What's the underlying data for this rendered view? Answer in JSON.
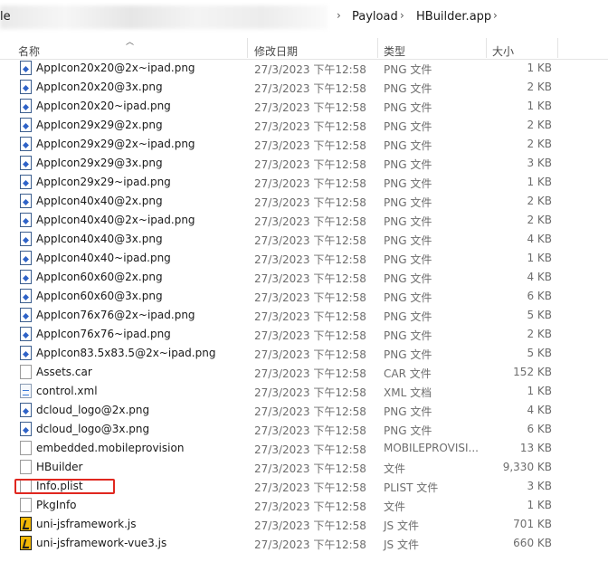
{
  "address_bar": {
    "prefix": "le",
    "breadcrumbs": [
      "Payload",
      "HBuilder.app"
    ],
    "separator": "›"
  },
  "columns": {
    "name": "名称",
    "date": "修改日期",
    "type": "类型",
    "size": "大小"
  },
  "files": [
    {
      "name": "AppIcon20x20@2x~ipad.png",
      "date": "27/3/2023 下午12:58",
      "type": "PNG 文件",
      "size": "1 KB",
      "icon": "png-file-icon"
    },
    {
      "name": "AppIcon20x20@3x.png",
      "date": "27/3/2023 下午12:58",
      "type": "PNG 文件",
      "size": "2 KB",
      "icon": "png-file-icon"
    },
    {
      "name": "AppIcon20x20~ipad.png",
      "date": "27/3/2023 下午12:58",
      "type": "PNG 文件",
      "size": "1 KB",
      "icon": "png-file-icon"
    },
    {
      "name": "AppIcon29x29@2x.png",
      "date": "27/3/2023 下午12:58",
      "type": "PNG 文件",
      "size": "2 KB",
      "icon": "png-file-icon"
    },
    {
      "name": "AppIcon29x29@2x~ipad.png",
      "date": "27/3/2023 下午12:58",
      "type": "PNG 文件",
      "size": "2 KB",
      "icon": "png-file-icon"
    },
    {
      "name": "AppIcon29x29@3x.png",
      "date": "27/3/2023 下午12:58",
      "type": "PNG 文件",
      "size": "3 KB",
      "icon": "png-file-icon"
    },
    {
      "name": "AppIcon29x29~ipad.png",
      "date": "27/3/2023 下午12:58",
      "type": "PNG 文件",
      "size": "1 KB",
      "icon": "png-file-icon"
    },
    {
      "name": "AppIcon40x40@2x.png",
      "date": "27/3/2023 下午12:58",
      "type": "PNG 文件",
      "size": "2 KB",
      "icon": "png-file-icon"
    },
    {
      "name": "AppIcon40x40@2x~ipad.png",
      "date": "27/3/2023 下午12:58",
      "type": "PNG 文件",
      "size": "2 KB",
      "icon": "png-file-icon"
    },
    {
      "name": "AppIcon40x40@3x.png",
      "date": "27/3/2023 下午12:58",
      "type": "PNG 文件",
      "size": "4 KB",
      "icon": "png-file-icon"
    },
    {
      "name": "AppIcon40x40~ipad.png",
      "date": "27/3/2023 下午12:58",
      "type": "PNG 文件",
      "size": "1 KB",
      "icon": "png-file-icon"
    },
    {
      "name": "AppIcon60x60@2x.png",
      "date": "27/3/2023 下午12:58",
      "type": "PNG 文件",
      "size": "4 KB",
      "icon": "png-file-icon"
    },
    {
      "name": "AppIcon60x60@3x.png",
      "date": "27/3/2023 下午12:58",
      "type": "PNG 文件",
      "size": "6 KB",
      "icon": "png-file-icon"
    },
    {
      "name": "AppIcon76x76@2x~ipad.png",
      "date": "27/3/2023 下午12:58",
      "type": "PNG 文件",
      "size": "5 KB",
      "icon": "png-file-icon"
    },
    {
      "name": "AppIcon76x76~ipad.png",
      "date": "27/3/2023 下午12:58",
      "type": "PNG 文件",
      "size": "2 KB",
      "icon": "png-file-icon"
    },
    {
      "name": "AppIcon83.5x83.5@2x~ipad.png",
      "date": "27/3/2023 下午12:58",
      "type": "PNG 文件",
      "size": "5 KB",
      "icon": "png-file-icon"
    },
    {
      "name": "Assets.car",
      "date": "27/3/2023 下午12:58",
      "type": "CAR 文件",
      "size": "152 KB",
      "icon": "generic-file-icon"
    },
    {
      "name": "control.xml",
      "date": "27/3/2023 下午12:58",
      "type": "XML 文档",
      "size": "1 KB",
      "icon": "xml-file-icon"
    },
    {
      "name": "dcloud_logo@2x.png",
      "date": "27/3/2023 下午12:58",
      "type": "PNG 文件",
      "size": "4 KB",
      "icon": "png-file-icon"
    },
    {
      "name": "dcloud_logo@3x.png",
      "date": "27/3/2023 下午12:58",
      "type": "PNG 文件",
      "size": "6 KB",
      "icon": "png-file-icon"
    },
    {
      "name": "embedded.mobileprovision",
      "date": "27/3/2023 下午12:58",
      "type": "MOBILEPROVISI...",
      "size": "13 KB",
      "icon": "generic-file-icon"
    },
    {
      "name": "HBuilder",
      "date": "27/3/2023 下午12:58",
      "type": "文件",
      "size": "9,330 KB",
      "icon": "generic-file-icon"
    },
    {
      "name": "Info.plist",
      "date": "27/3/2023 下午12:58",
      "type": "PLIST 文件",
      "size": "3 KB",
      "icon": "generic-file-icon"
    },
    {
      "name": "PkgInfo",
      "date": "27/3/2023 下午12:58",
      "type": "文件",
      "size": "1 KB",
      "icon": "generic-file-icon"
    },
    {
      "name": "uni-jsframework.js",
      "date": "27/3/2023 下午12:58",
      "type": "JS 文件",
      "size": "701 KB",
      "icon": "js-file-icon"
    },
    {
      "name": "uni-jsframework-vue3.js",
      "date": "27/3/2023 下午12:58",
      "type": "JS 文件",
      "size": "660 KB",
      "icon": "js-file-icon"
    }
  ],
  "colors": {
    "highlight_border": "#e0271f",
    "png_icon_accent": "#2f63c8",
    "js_icon_bg": "#f2b705"
  }
}
